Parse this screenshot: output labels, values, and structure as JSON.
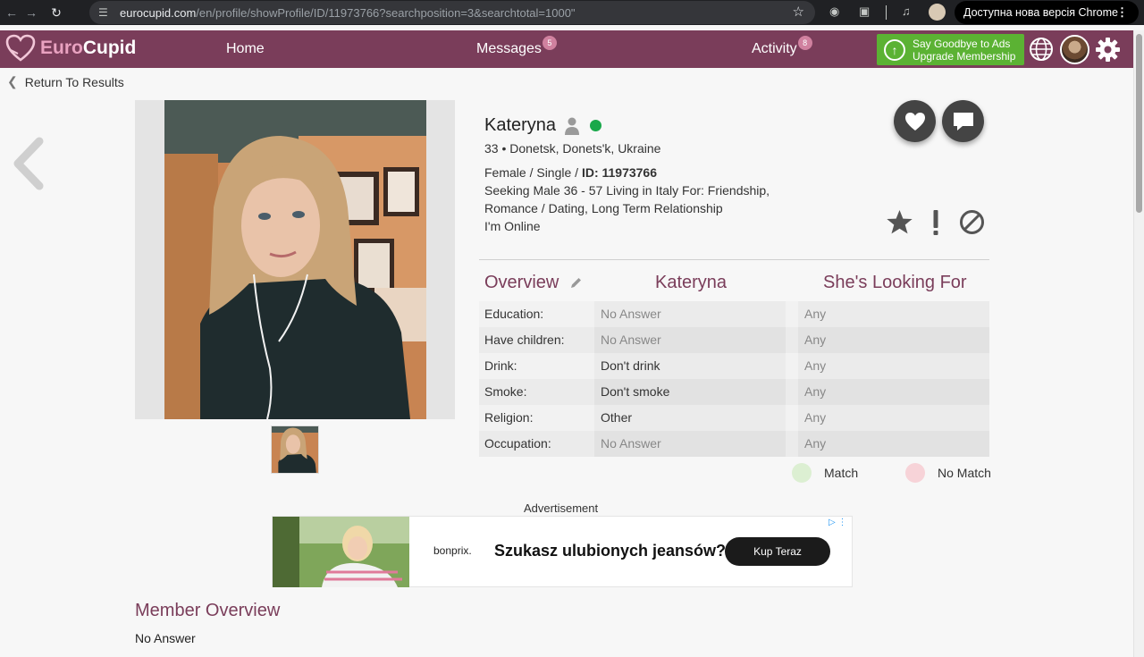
{
  "browser": {
    "url_domain": "eurocupid.com",
    "url_path": "/en/profile/showProfile/ID/11973766?searchposition=3&searchtotal=1000\"",
    "update_label": "Доступна нова версія Chrome"
  },
  "header": {
    "brand_part1": "Euro",
    "brand_part2": "Cupid",
    "nav": {
      "home": "Home",
      "messages": "Messages",
      "messages_badge": "5",
      "activity": "Activity",
      "activity_badge": "8"
    },
    "ads_line1": "Say Goodbye to Ads",
    "ads_line2": "Upgrade Membership"
  },
  "return_link": "Return To Results",
  "profile": {
    "name": "Kateryna",
    "age_location": "33 • Donetsk, Donets'k, Ukraine",
    "gender_status": "Female / Single / ",
    "id_label": "ID: 11973766",
    "seeking_line1": "Seeking Male 36 - 57 Living in Italy For: Friendship,",
    "seeking_line2": "Romance / Dating, Long Term Relationship",
    "online_status": "I'm Online"
  },
  "overview": {
    "heading": "Overview",
    "col_name": "Kateryna",
    "col_looking": "She's Looking For",
    "rows": [
      {
        "label": "Education:",
        "value": "No Answer",
        "looking": "Any"
      },
      {
        "label": "Have children:",
        "value": "No Answer",
        "looking": "Any"
      },
      {
        "label": "Drink:",
        "value": "Don't drink",
        "looking": "Any"
      },
      {
        "label": "Smoke:",
        "value": "Don't smoke",
        "looking": "Any"
      },
      {
        "label": "Religion:",
        "value": "Other",
        "looking": "Any"
      },
      {
        "label": "Occupation:",
        "value": "No Answer",
        "looking": "Any"
      }
    ],
    "legend_match": "Match",
    "legend_no_match": "No Match"
  },
  "advertisement": {
    "label": "Advertisement",
    "brand": "bonprix.",
    "headline": "Szukasz ulubionych jeansów?",
    "cta": "Kup Teraz"
  },
  "member_overview": {
    "heading": "Member Overview",
    "text": "No Answer"
  },
  "colors": {
    "brand": "#7a3d5a",
    "upgrade": "#5bb233",
    "online": "#19a84a",
    "match": "#dcefd2",
    "no_match": "#f7d3d8"
  }
}
